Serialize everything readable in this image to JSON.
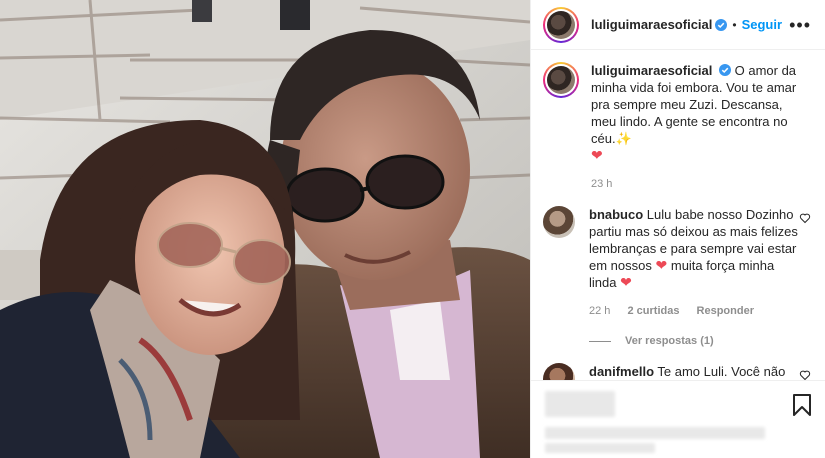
{
  "post": {
    "username": "luliguimaraesoficial",
    "follow_label": "Seguir",
    "more_label": "•••"
  },
  "caption": {
    "username": "luliguimaraesoficial",
    "text": "O amor da minha vida foi embora. Vou te amar pra sempre meu Zuzi. Descansa, meu lindo. A gente se encontra no céu.",
    "sparkle": "✨",
    "heart": "❤",
    "time": "23 h"
  },
  "comments": [
    {
      "username": "bnabuco",
      "text": "Lulu babe nosso Dozinho partiu mas só deixou as mais felizes lembranças e para sempre vai estar em nossos",
      "heart1": "❤",
      "text2": "muita força minha linda",
      "heart2": "❤",
      "time": "22 h",
      "likes": "2 curtidas",
      "reply": "Responder",
      "view_replies": "Ver respostas (1)"
    },
    {
      "username": "danifmello",
      "text": "Te amo Luli. Você não"
    }
  ],
  "icons": {
    "verified": "verified-badge-icon",
    "like": "heart-outline-icon",
    "bookmark": "bookmark-icon",
    "more": "more-options-icon"
  },
  "colors": {
    "accent_blue": "#0095f6",
    "verified_blue": "#3897f0",
    "heart_red": "#ed4956",
    "muted_text": "#8e8e8e",
    "border": "#efefef"
  }
}
